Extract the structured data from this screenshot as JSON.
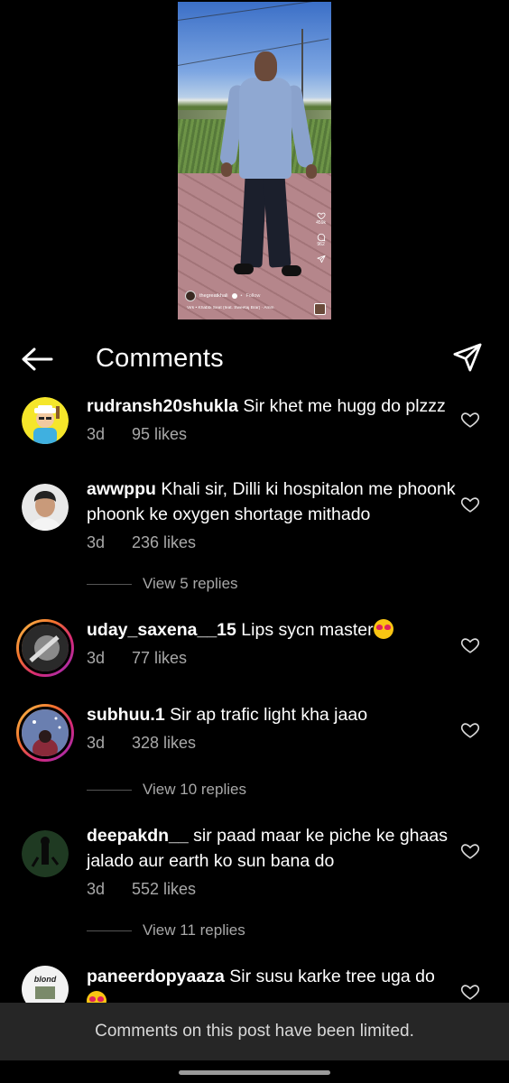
{
  "video": {
    "stats": {
      "likes": "459k",
      "comments": "962"
    },
    "owner": "thegreatkhali",
    "follow_label": "Follow",
    "music": "Virk • Khabbi Seat (feat. Sweetaj Brar) · Amm"
  },
  "header": {
    "title": "Comments"
  },
  "comments": [
    {
      "username": "rudransh20shukla",
      "text": "Sir khet me hugg do plzzz",
      "time": "3d",
      "likes": "95 likes"
    },
    {
      "username": "awwppu",
      "text": "Khali sir, Dilli ki hospitalon me phoonk phoonk ke oxygen shortage mithado",
      "time": "3d",
      "likes": "236 likes",
      "replies": "View 5 replies"
    },
    {
      "username": "uday_saxena__15",
      "text": "Lips sycn master",
      "time": "3d",
      "likes": "77 likes"
    },
    {
      "username": "subhuu.1",
      "text": "Sir ap trafic light kha jaao",
      "time": "3d",
      "likes": "328 likes",
      "replies": "View 10 replies"
    },
    {
      "username": "deepakdn__",
      "text": "sir paad maar ke piche ke ghaas jalado aur earth ko sun bana do",
      "time": "3d",
      "likes": "552 likes",
      "replies": "View 11 replies"
    },
    {
      "username": "paneerdopyaaza",
      "text": "Sir susu karke tree uga do",
      "avatar_text": "blond"
    }
  ],
  "banner": {
    "text": "Comments on this post have been limited."
  }
}
